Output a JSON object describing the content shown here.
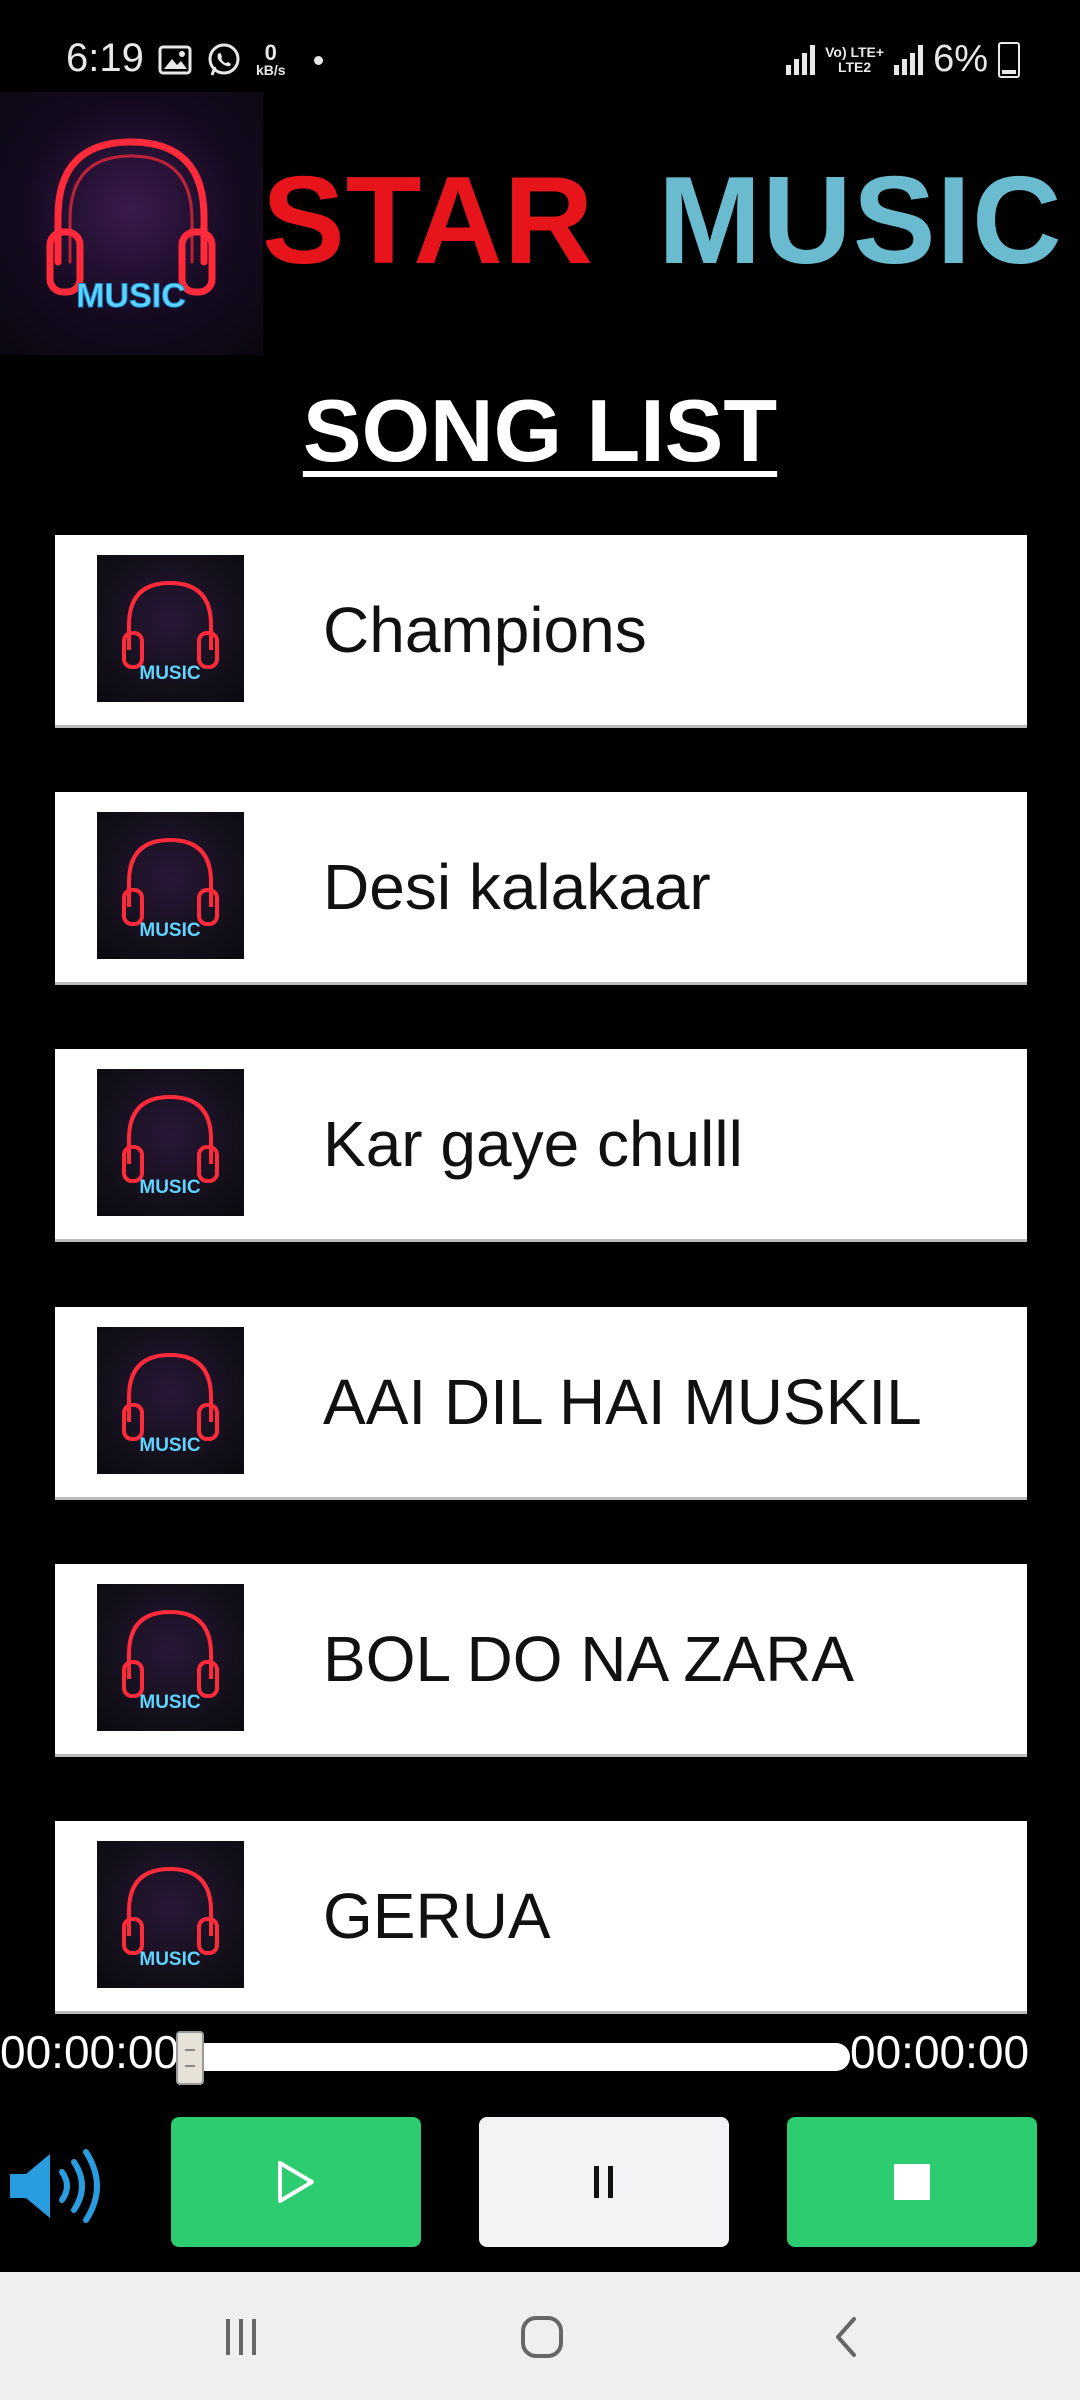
{
  "status_bar": {
    "time": "6:19",
    "kbs_value": "0",
    "kbs_unit": "kB/s",
    "network_top": "Vo) LTE+",
    "network_bottom": "LTE2",
    "battery": "6%"
  },
  "header": {
    "logo_text": "MUSIC",
    "title_star": "STAR",
    "title_music": "MUSIC",
    "colors": {
      "star": "#e8141c",
      "music": "#6bbbd0"
    }
  },
  "song_list": {
    "heading": "SONG LIST",
    "thumb_label": "MUSIC",
    "items": [
      {
        "title": "Champions"
      },
      {
        "title": "Desi kalakaar"
      },
      {
        "title": "Kar gaye chulll"
      },
      {
        "title": "AAI DIL HAI MUSKIL"
      },
      {
        "title": "BOL DO NA ZARA"
      },
      {
        "title": "GERUA"
      }
    ]
  },
  "player": {
    "current_time": "00:00:00",
    "total_time": "00:00:00",
    "progress": 0,
    "accent_color": "#2ecc71",
    "icons": [
      "volume-icon",
      "play-icon",
      "pause-icon",
      "stop-icon"
    ]
  },
  "nav_bar": {
    "icons": [
      "recent-apps-icon",
      "home-icon",
      "back-icon"
    ]
  }
}
